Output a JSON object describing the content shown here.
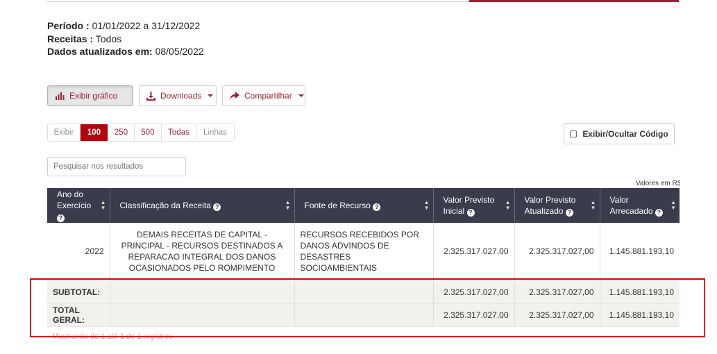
{
  "info": {
    "periodo_label": "Período :",
    "periodo_value": "01/01/2022 a 31/12/2022",
    "receitas_label": "Receitas :",
    "receitas_value": "Todos",
    "dados_label": "Dados atualizados em:",
    "dados_value": "08/05/2022"
  },
  "toolbar": {
    "grafico_label": "Exibir gráfico",
    "downloads_label": "Downloads",
    "compartilhar_label": "Compartilhar"
  },
  "pager": {
    "exibir": "Exibir",
    "options": [
      "100",
      "250",
      "500",
      "Todas"
    ],
    "selected": "100",
    "linhas": "Linhas"
  },
  "toggle_code_label": "Exibir/Ocultar Código",
  "search": {
    "placeholder": "Pesquisar nos resultados"
  },
  "units_note": "Valores em R$",
  "table": {
    "headers": [
      {
        "line1": "Ano do",
        "line2": "Exercício"
      },
      {
        "line1": "Classificação da Receita",
        "line2": ""
      },
      {
        "line1": "Fonte de Recurso",
        "line2": ""
      },
      {
        "line1": "Valor Previsto",
        "line2": "Inicial"
      },
      {
        "line1": "Valor Previsto",
        "line2": "Atualizado"
      },
      {
        "line1": "Valor",
        "line2": "Arrecadado"
      }
    ],
    "row": {
      "ano": "2022",
      "classificacao": "DEMAIS RECEITAS DE CAPITAL - PRINCIPAL - RECURSOS DESTINADOS A REPARACAO INTEGRAL DOS DANOS OCASIONADOS PELO ROMPIMENTO",
      "fonte": "RECURSOS RECEBIDOS POR DANOS ADVINDOS DE DESASTRES SOCIOAMBIENTAIS",
      "previsto_inicial": "2.325.317.027,00",
      "previsto_atualizado": "2.325.317.027,00",
      "arrecadado": "1.145.881.193,10"
    },
    "subtotal": {
      "label": "SUBTOTAL:",
      "previsto_inicial": "2.325.317.027,00",
      "previsto_atualizado": "2.325.317.027,00",
      "arrecadado": "1.145.881.193,10"
    },
    "total": {
      "label": "TOTAL GERAL:",
      "previsto_inicial": "2.325.317.027,00",
      "previsto_atualizado": "2.325.317.027,00",
      "arrecadado": "1.145.881.193,10"
    }
  },
  "footer_text": "Mostrando de 1 até 1 de 1 registros",
  "colors": {
    "accent": "#9b2335",
    "header_bg": "#3a3b4b",
    "highlight": "#e0000b"
  }
}
